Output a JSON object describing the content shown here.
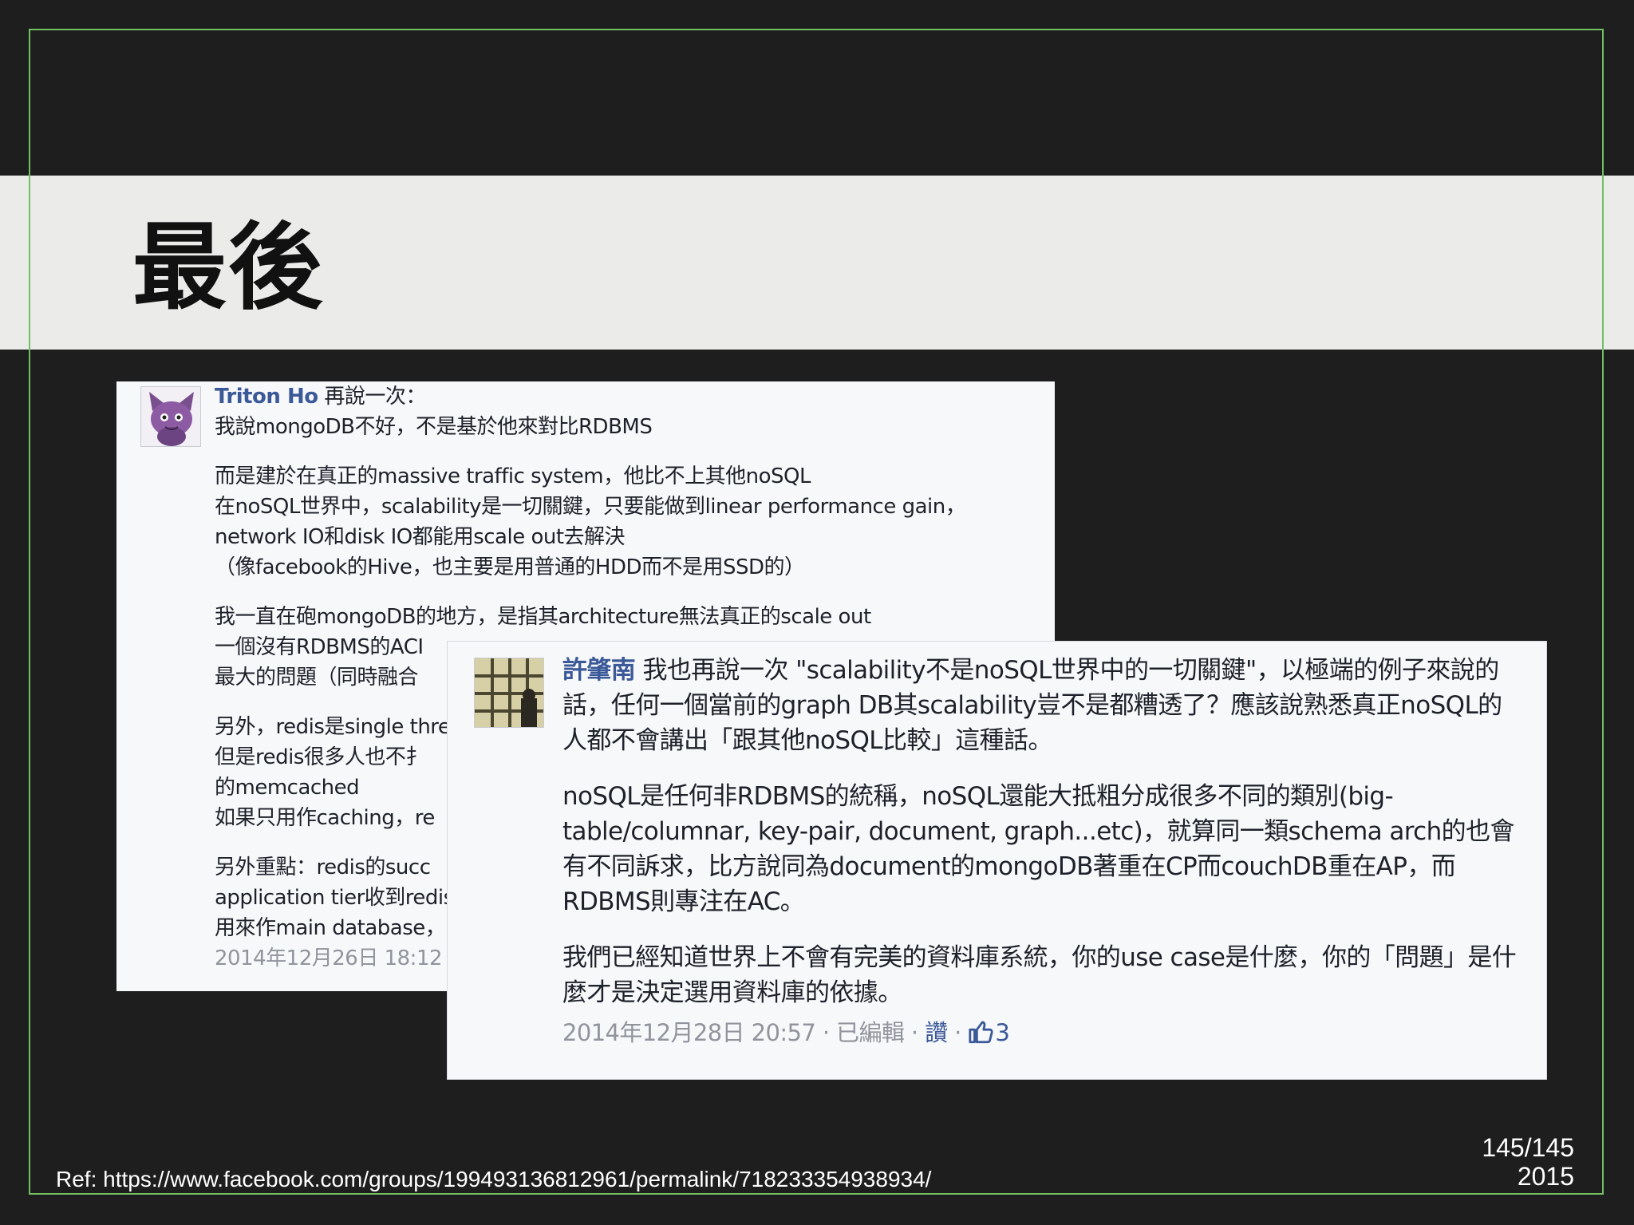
{
  "slide": {
    "title": "最後",
    "reference": "Ref: https://www.facebook.com/groups/199493136812961/permalink/718233354938934/",
    "page_number": "145/145",
    "year": "2015"
  },
  "comment1": {
    "author": "Triton Ho",
    "intro": " 再說一次：",
    "line1": "我說mongoDB不好，不是基於他來對比RDBMS",
    "para2_l1": "而是建於在真正的massive traffic system，他比不上其他noSQL",
    "para2_l2": "在noSQL世界中，scalability是一切關鍵，只要能做到linear performance gain，",
    "para2_l3": "network IO和disk IO都能用scale out去解決",
    "para2_l4": "（像facebook的Hive，也主要是用普通的HDD而不是用SSD的）",
    "para3_l1": "我一直在砲mongoDB的地方，是指其architecture無法真正的scale out",
    "para3_l2": "一個沒有RDBMS的ACI",
    "para3_l3": "最大的問題（同時融合",
    "para4_l1": "另外，redis是single thre",
    "para4_l2": "但是redis很多人也不扌",
    "para4_l3": "的memcached",
    "para4_l4": "如果只用作caching，re",
    "para5_l1": "另外重點：redis的succ",
    "para5_l2": "application tier收到redis",
    "para5_l3": "用來作main database，",
    "timestamp": "2014年12月26日 18:12 ·"
  },
  "comment2": {
    "author": "許肇南",
    "para1": " 我也再說一次 \"scalability不是noSQL世界中的一切關鍵\"，以極端的例子來說的話，任何一個當前的graph DB其scalability豈不是都糟透了？應該說熟悉真正noSQL的人都不會講出「跟其他noSQL比較」這種話。",
    "para2": "noSQL是任何非RDBMS的統稱，noSQL還能大抵粗分成很多不同的類別(big-table/columnar, key-pair, document, graph...etc)，就算同一類schema arch的也會有不同訴求，比方說同為document的mongoDB著重在CP而couchDB重在AP，而RDBMS則專注在AC。",
    "para3": "我們已經知道世界上不會有完美的資料庫系統，你的use case是什麼，你的「問題」是什麼才是決定選用資料庫的依據。",
    "timestamp": "2014年12月28日 20:57 · 已編輯 · ",
    "like_label": "讚",
    "sep": " · ",
    "like_count": "3"
  }
}
